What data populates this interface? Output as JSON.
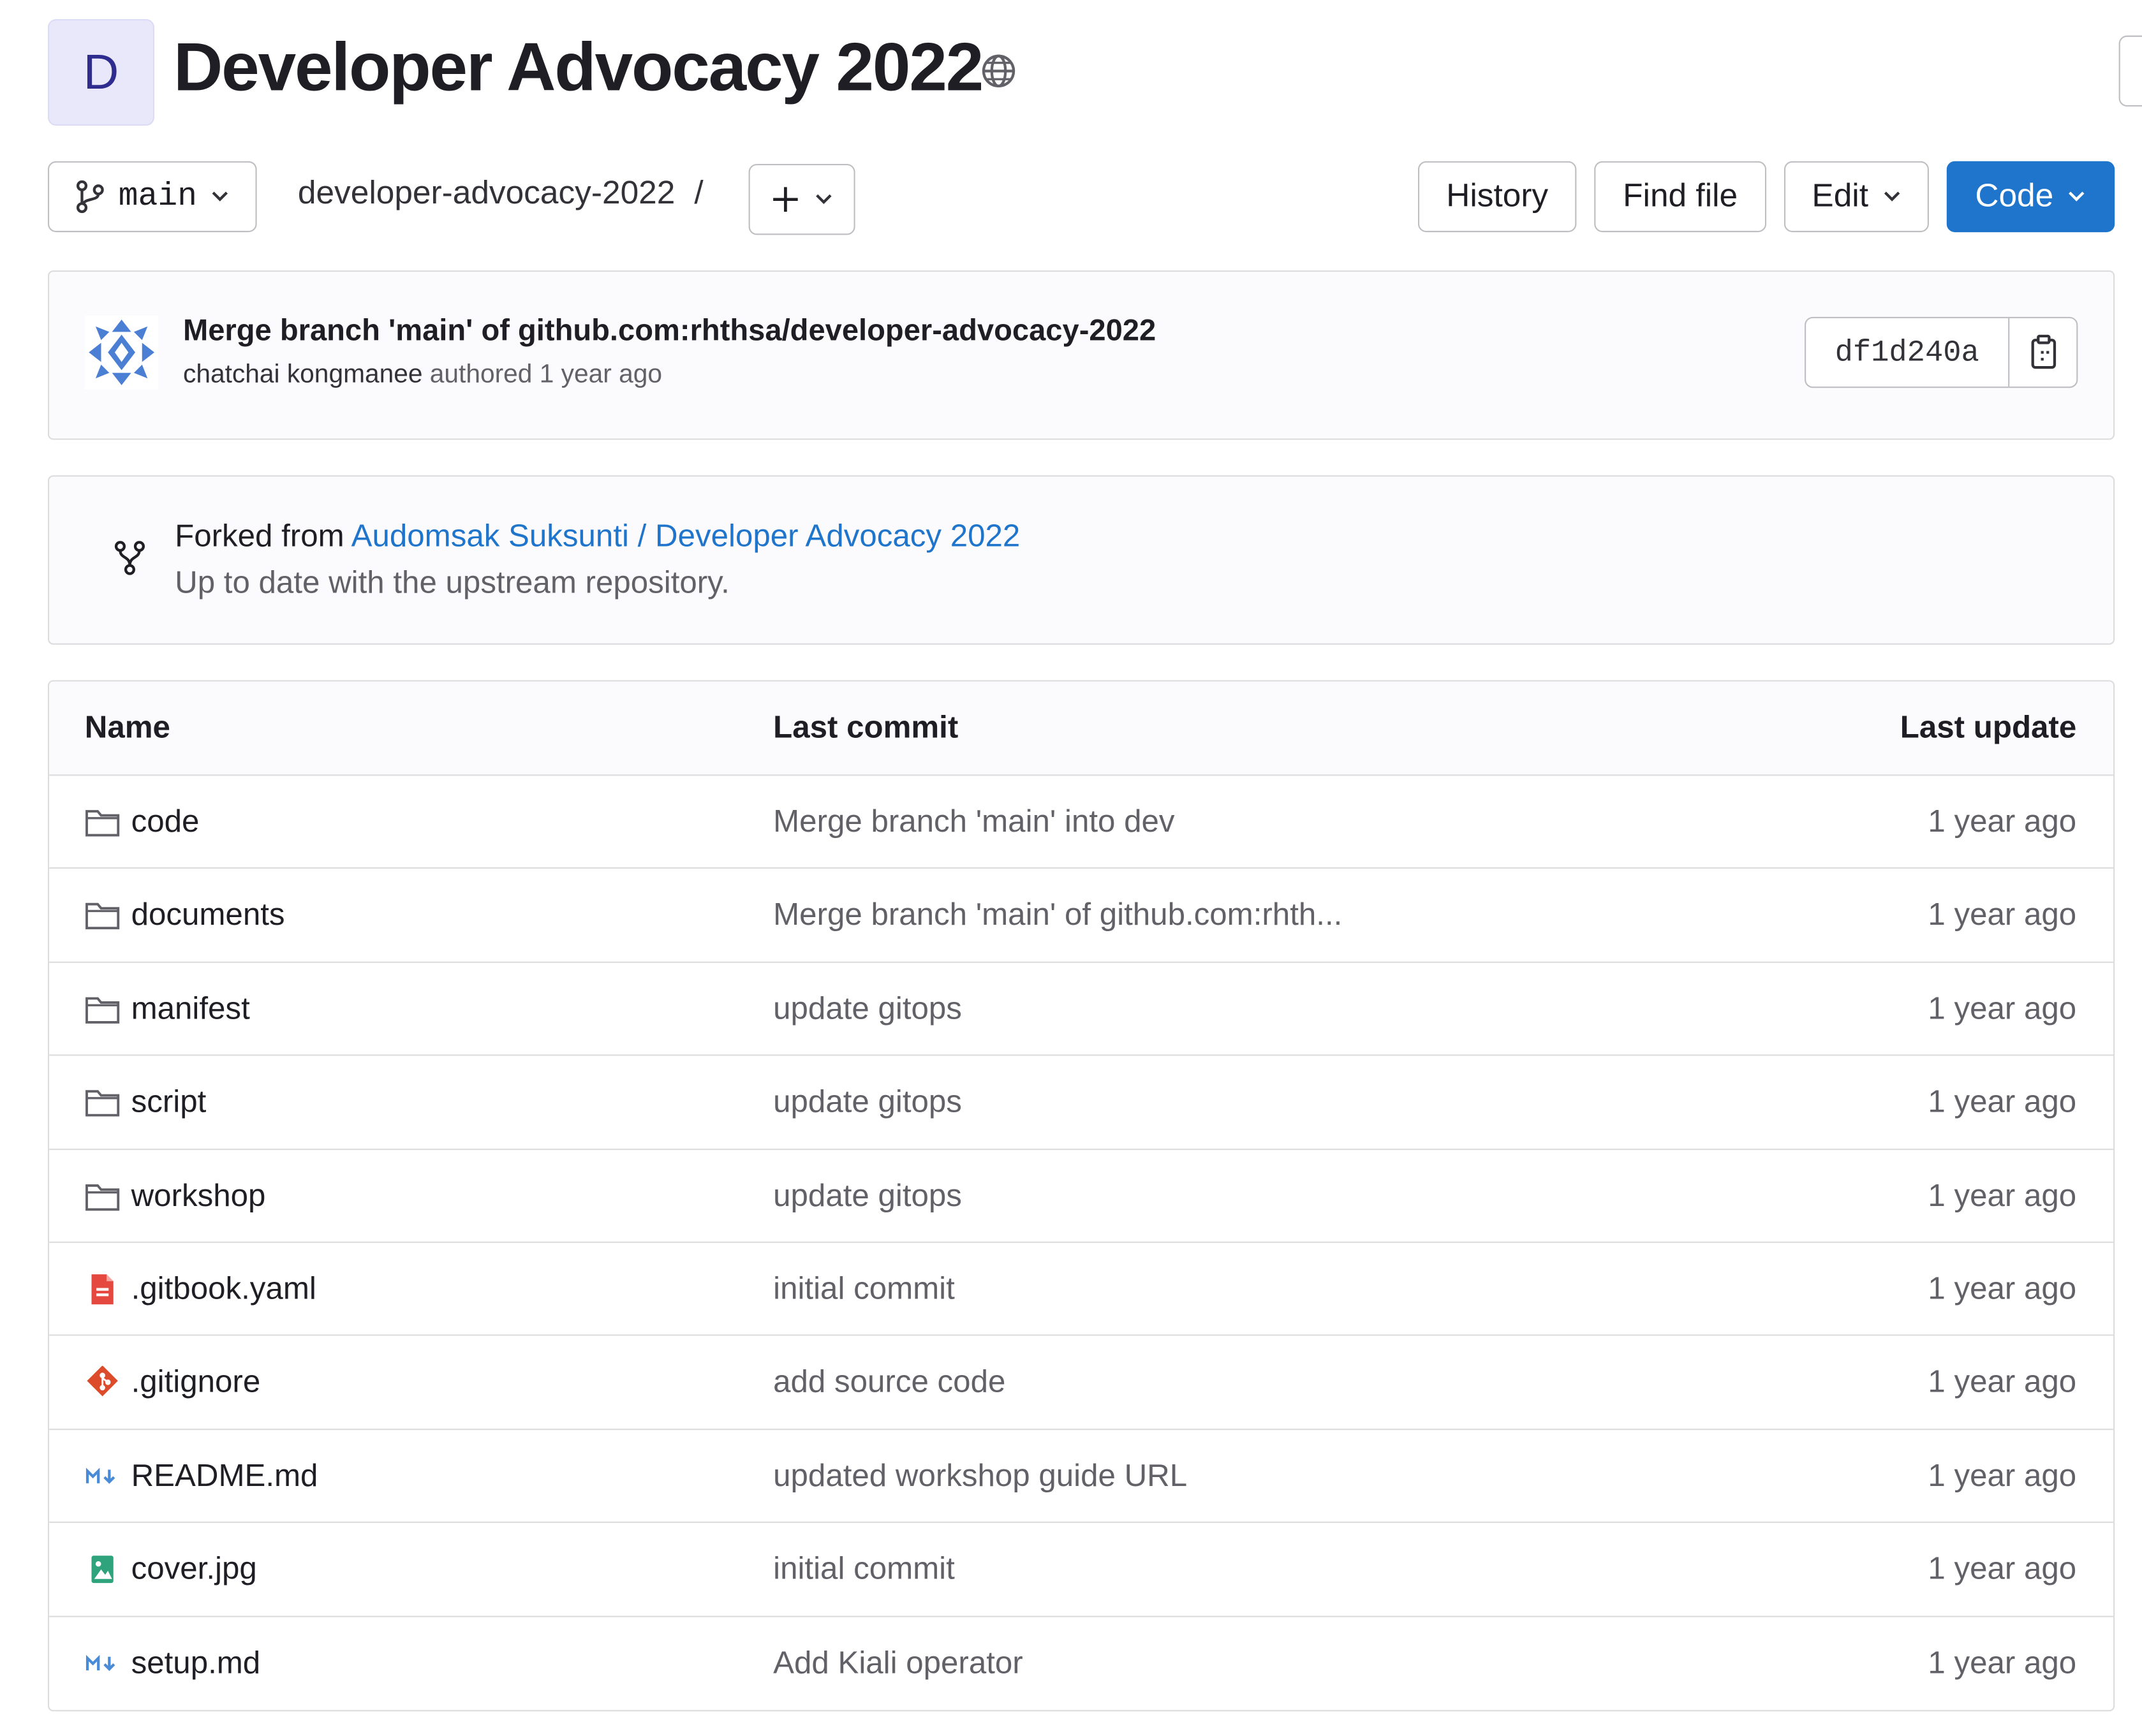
{
  "project": {
    "avatar_letter": "D",
    "title": "Developer Advocacy 2022",
    "visibility_icon": "globe-icon"
  },
  "toolbar": {
    "branch": "main",
    "path": "developer-advocacy-2022",
    "path_separator": "/",
    "history_label": "History",
    "find_file_label": "Find file",
    "edit_label": "Edit",
    "code_label": "Code"
  },
  "last_commit": {
    "title": "Merge branch 'main' of github.com:rhthsa/developer-advocacy-2022",
    "author": "chatchai kongmanee",
    "authored_text": "authored 1 year ago",
    "sha": "df1d240a"
  },
  "fork": {
    "prefix": "Forked from",
    "source": "Audomsak Suksunti / Developer Advocacy 2022",
    "status": "Up to date with the upstream repository."
  },
  "table": {
    "headers": {
      "name": "Name",
      "last_commit": "Last commit",
      "last_update": "Last update"
    },
    "rows": [
      {
        "type": "folder",
        "icon": "folder-icon",
        "name": "code",
        "commit": "Merge branch 'main' into dev",
        "updated": "1 year ago"
      },
      {
        "type": "folder",
        "icon": "folder-icon",
        "name": "documents",
        "commit": "Merge branch 'main' of github.com:rhth...",
        "updated": "1 year ago"
      },
      {
        "type": "folder",
        "icon": "folder-icon",
        "name": "manifest",
        "commit": "update gitops",
        "updated": "1 year ago"
      },
      {
        "type": "folder",
        "icon": "folder-icon",
        "name": "script",
        "commit": "update gitops",
        "updated": "1 year ago"
      },
      {
        "type": "folder",
        "icon": "folder-icon",
        "name": "workshop",
        "commit": "update gitops",
        "updated": "1 year ago"
      },
      {
        "type": "file",
        "icon": "yaml-file-icon",
        "name": ".gitbook.yaml",
        "commit": "initial commit",
        "updated": "1 year ago"
      },
      {
        "type": "file",
        "icon": "git-file-icon",
        "name": ".gitignore",
        "commit": "add source code",
        "updated": "1 year ago"
      },
      {
        "type": "file",
        "icon": "markdown-file-icon",
        "name": "README.md",
        "commit": "updated workshop guide URL",
        "updated": "1 year ago"
      },
      {
        "type": "file",
        "icon": "image-file-icon",
        "name": "cover.jpg",
        "commit": "initial commit",
        "updated": "1 year ago"
      },
      {
        "type": "file",
        "icon": "markdown-file-icon",
        "name": "setup.md",
        "commit": "Add Kiali operator",
        "updated": "1 year ago"
      }
    ]
  },
  "colors": {
    "primary": "#1f75cb",
    "link": "#1f75cb",
    "text": "#1f1e24",
    "muted": "#626168",
    "border": "#dcdcde",
    "panel_bg": "#fbfafd",
    "avatar_bg": "#e9e8fb"
  }
}
